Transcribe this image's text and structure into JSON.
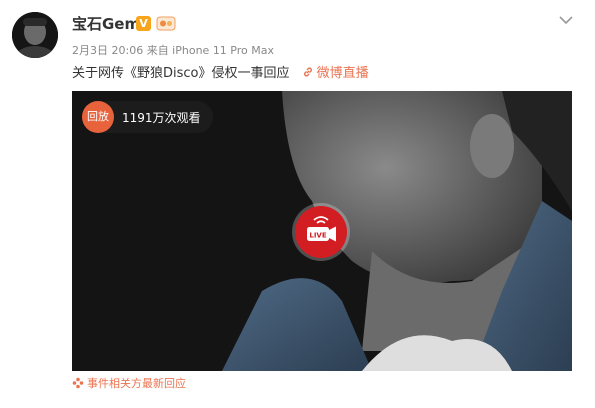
{
  "post": {
    "username": "宝石Gem",
    "verified_badge": "V",
    "meta": "2月3日 20:06 来自 iPhone 11 Pro Max",
    "title": "关于网传《野狼Disco》侵权一事回应",
    "live_link": "微博直播",
    "icons": [
      "verified-badge",
      "fan-badge-icon",
      "chevron-down-icon",
      "link-icon"
    ]
  },
  "video": {
    "replay_label": "回放",
    "views": "1191万次观看",
    "live_label": "LIVE",
    "icons": [
      "live-camera-icon"
    ]
  },
  "footer": {
    "related_text": "事件相关方最新回应",
    "icon": "flower-icon"
  },
  "colors": {
    "accent": "#eb7350",
    "live_red": "#d21d23",
    "replay_orange": "#e8623c",
    "verified_gold": "#f8a51c"
  }
}
